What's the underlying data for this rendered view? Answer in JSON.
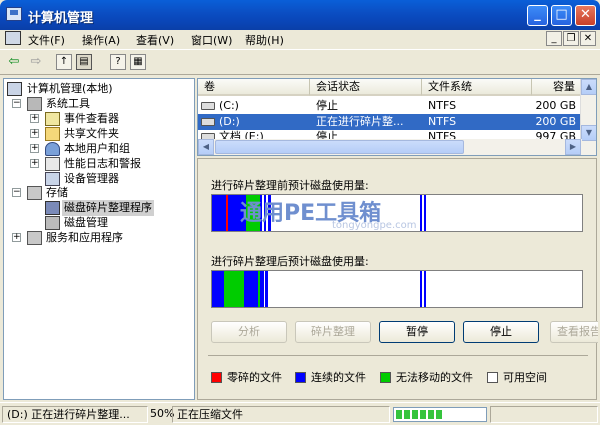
{
  "window": {
    "title": "计算机管理"
  },
  "menu": {
    "items": [
      "文件(F)",
      "操作(A)",
      "查看(V)",
      "窗口(W)",
      "帮助(H)"
    ]
  },
  "tree": {
    "root": "计算机管理(本地)",
    "system_tools": "系统工具",
    "event_viewer": "事件查看器",
    "shared_folders": "共享文件夹",
    "local_users": "本地用户和组",
    "perf_logs": "性能日志和警报",
    "device_manager": "设备管理器",
    "storage": "存储",
    "defrag": "磁盘碎片整理程序",
    "disk_mgmt": "磁盘管理",
    "services": "服务和应用程序"
  },
  "list": {
    "columns": [
      "卷",
      "会话状态",
      "文件系统",
      "容量"
    ],
    "rows": [
      {
        "volume": "(C:)",
        "status": "停止",
        "fs": "NTFS",
        "capacity": "200 GB"
      },
      {
        "volume": "(D:)",
        "status": "正在进行碎片整...",
        "fs": "NTFS",
        "capacity": "200 GB"
      },
      {
        "volume": "文档 (E:)",
        "status": "停止",
        "fs": "NTFS",
        "capacity": "997 GB"
      }
    ]
  },
  "analysis": {
    "before_label": "进行碎片整理前预计磁盘使用量:",
    "after_label": "进行碎片整理后预计磁盘使用量:",
    "watermark": "通用PE工具箱",
    "watermark_url": "tongyongpe.com"
  },
  "buttons": {
    "analyze": "分析",
    "defrag": "碎片整理",
    "pause": "暂停",
    "stop": "停止",
    "view_report": "查看报告"
  },
  "legend": {
    "fragmented": "零碎的文件",
    "contiguous": "连续的文件",
    "unmovable": "无法移动的文件",
    "free": "可用空间"
  },
  "colors": {
    "fragmented": "#ff0000",
    "contiguous": "#0000ff",
    "unmovable": "#00cc00",
    "free": "#ffffff",
    "selection": "#316ac5"
  },
  "status": {
    "message": "(D:) 正在进行碎片整理...",
    "percent": "50%",
    "action": "正在压缩文件",
    "progress": 0.55
  }
}
